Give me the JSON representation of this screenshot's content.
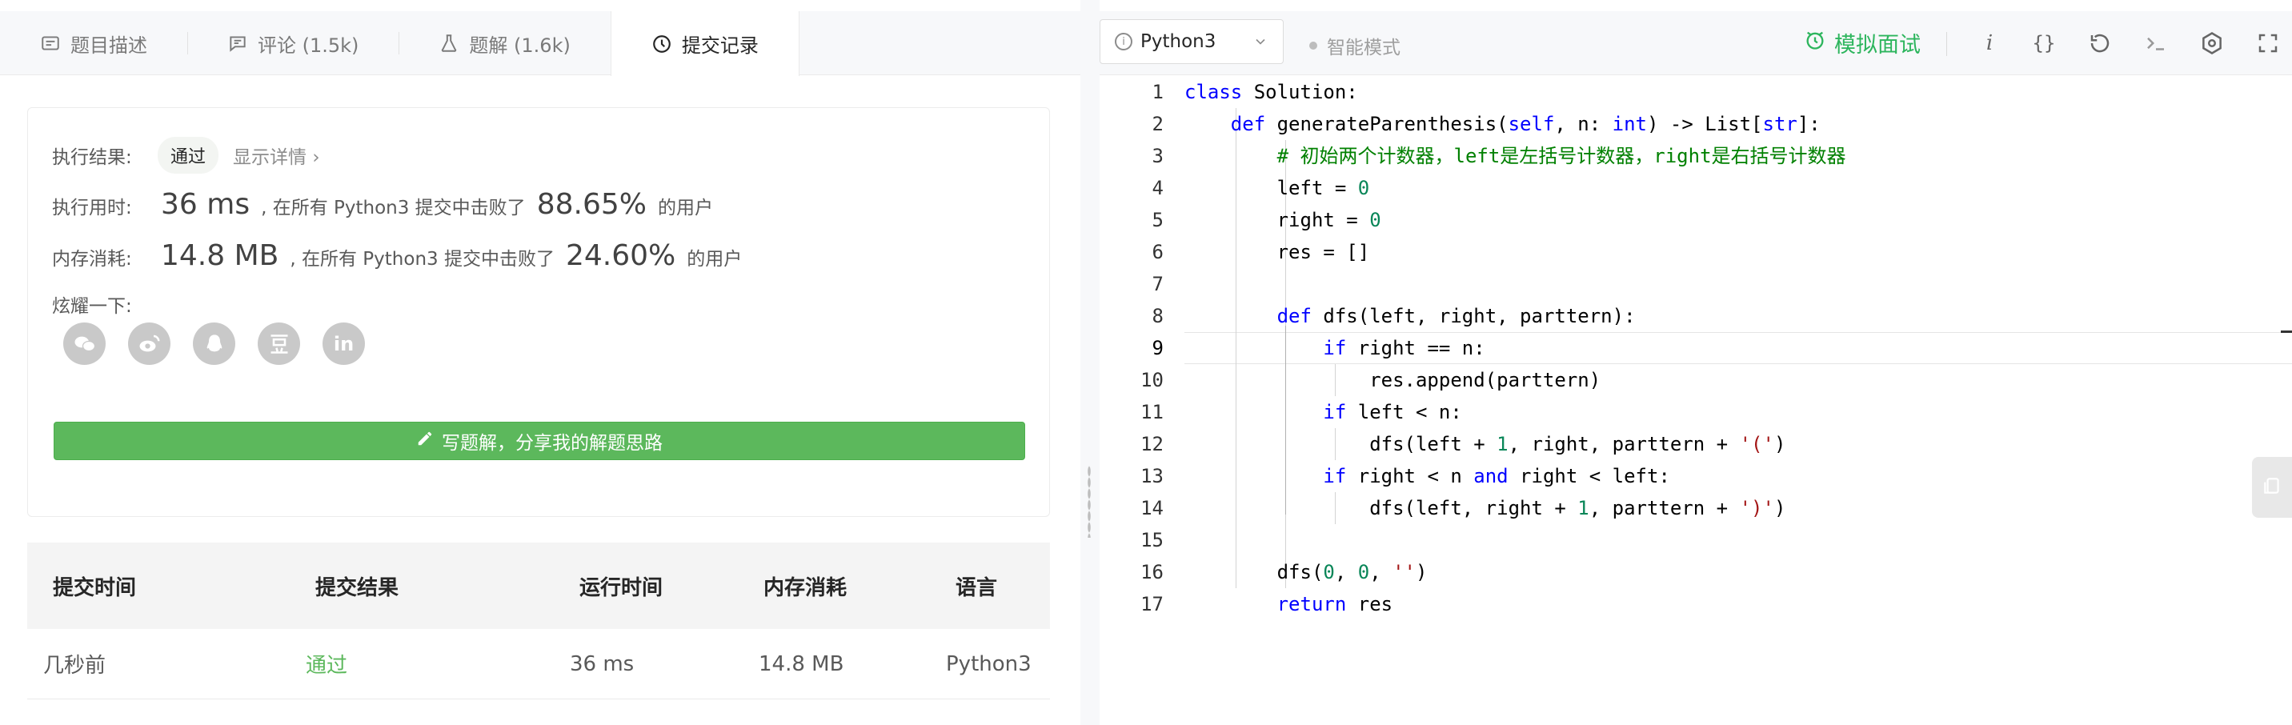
{
  "tabs": [
    {
      "label": "题目描述",
      "icon": "description-icon",
      "active": false
    },
    {
      "label": "评论 (1.5k)",
      "icon": "comment-icon",
      "active": false
    },
    {
      "label": "题解 (1.6k)",
      "icon": "flask-icon",
      "active": false
    },
    {
      "label": "提交记录",
      "icon": "clock-icon",
      "active": true
    }
  ],
  "result": {
    "status_label": "执行结果:",
    "status_value": "通过",
    "details_link": "显示详情 ›",
    "time_label": "执行用时:",
    "time_value": "36 ms",
    "time_mid": ", 在所有 Python3 提交中击败了",
    "time_percent": "88.65%",
    "time_suffix": "的用户",
    "memory_label": "内存消耗:",
    "memory_value": "14.8 MB",
    "memory_mid": ", 在所有 Python3 提交中击败了",
    "memory_percent": "24.60%",
    "memory_suffix": "的用户",
    "share_label": "炫耀一下:",
    "share_icons": [
      "wechat-icon",
      "weibo-icon",
      "qq-icon",
      "douban-icon",
      "linkedin-icon"
    ],
    "write_button": "写题解，分享我的解题思路"
  },
  "submissions": {
    "headers": [
      "提交时间",
      "提交结果",
      "运行时间",
      "内存消耗",
      "语言"
    ],
    "rows": [
      {
        "time": "几秒前",
        "result": "通过",
        "runtime": "36 ms",
        "memory": "14.8 MB",
        "language": "Python3"
      }
    ]
  },
  "toolbar": {
    "language": "Python3",
    "smart_mode": "智能模式",
    "mock_interview": "模拟面试",
    "icons": [
      "info-italic-icon",
      "braces-icon",
      "reset-icon",
      "console-icon",
      "settings-icon",
      "fullscreen-icon"
    ]
  },
  "colors": {
    "accent_green": "#2db55d",
    "pass_green": "#5cb85c",
    "keyword": "#0000ff",
    "number": "#098658",
    "string": "#a31515",
    "comment": "#008000"
  },
  "editor": {
    "active_line": 9,
    "line_numbers": [
      "1",
      "2",
      "3",
      "4",
      "5",
      "6",
      "7",
      "8",
      "9",
      "10",
      "11",
      "12",
      "13",
      "14",
      "15",
      "16",
      "17"
    ],
    "lines": [
      [
        {
          "t": "class",
          "c": "kw"
        },
        {
          "t": " Solution:"
        }
      ],
      [
        {
          "t": "    "
        },
        {
          "t": "def",
          "c": "kw"
        },
        {
          "t": " generateParenthesis("
        },
        {
          "t": "self",
          "c": "kw"
        },
        {
          "t": ", n: "
        },
        {
          "t": "int",
          "c": "kw"
        },
        {
          "t": ") -> List["
        },
        {
          "t": "str",
          "c": "kw"
        },
        {
          "t": "]:"
        }
      ],
      [
        {
          "t": "        "
        },
        {
          "t": "# 初始两个计数器，left是左括号计数器，right是右括号计数器",
          "c": "cmt"
        }
      ],
      [
        {
          "t": "        left = "
        },
        {
          "t": "0",
          "c": "num"
        }
      ],
      [
        {
          "t": "        right = "
        },
        {
          "t": "0",
          "c": "num"
        }
      ],
      [
        {
          "t": "        res = []"
        }
      ],
      [
        {
          "t": ""
        }
      ],
      [
        {
          "t": "        "
        },
        {
          "t": "def",
          "c": "kw"
        },
        {
          "t": " dfs(left, right, parttern):"
        }
      ],
      [
        {
          "t": "            "
        },
        {
          "t": "if",
          "c": "kw"
        },
        {
          "t": " right == n:"
        }
      ],
      [
        {
          "t": "                res.append(parttern)"
        }
      ],
      [
        {
          "t": "            "
        },
        {
          "t": "if",
          "c": "kw"
        },
        {
          "t": " left < n:"
        }
      ],
      [
        {
          "t": "                dfs(left + "
        },
        {
          "t": "1",
          "c": "num"
        },
        {
          "t": ", right, parttern + "
        },
        {
          "t": "'('",
          "c": "str"
        },
        {
          "t": ")"
        }
      ],
      [
        {
          "t": "            "
        },
        {
          "t": "if",
          "c": "kw"
        },
        {
          "t": " right < n "
        },
        {
          "t": "and",
          "c": "kw"
        },
        {
          "t": " right < left:"
        }
      ],
      [
        {
          "t": "                dfs(left, right + "
        },
        {
          "t": "1",
          "c": "num"
        },
        {
          "t": ", parttern + "
        },
        {
          "t": "')'",
          "c": "str"
        },
        {
          "t": ")"
        }
      ],
      [
        {
          "t": ""
        }
      ],
      [
        {
          "t": "        dfs("
        },
        {
          "t": "0",
          "c": "num"
        },
        {
          "t": ", "
        },
        {
          "t": "0",
          "c": "num"
        },
        {
          "t": ", "
        },
        {
          "t": "''",
          "c": "str"
        },
        {
          "t": ")"
        }
      ],
      [
        {
          "t": "        "
        },
        {
          "t": "return",
          "c": "kw"
        },
        {
          "t": " res"
        }
      ]
    ]
  }
}
